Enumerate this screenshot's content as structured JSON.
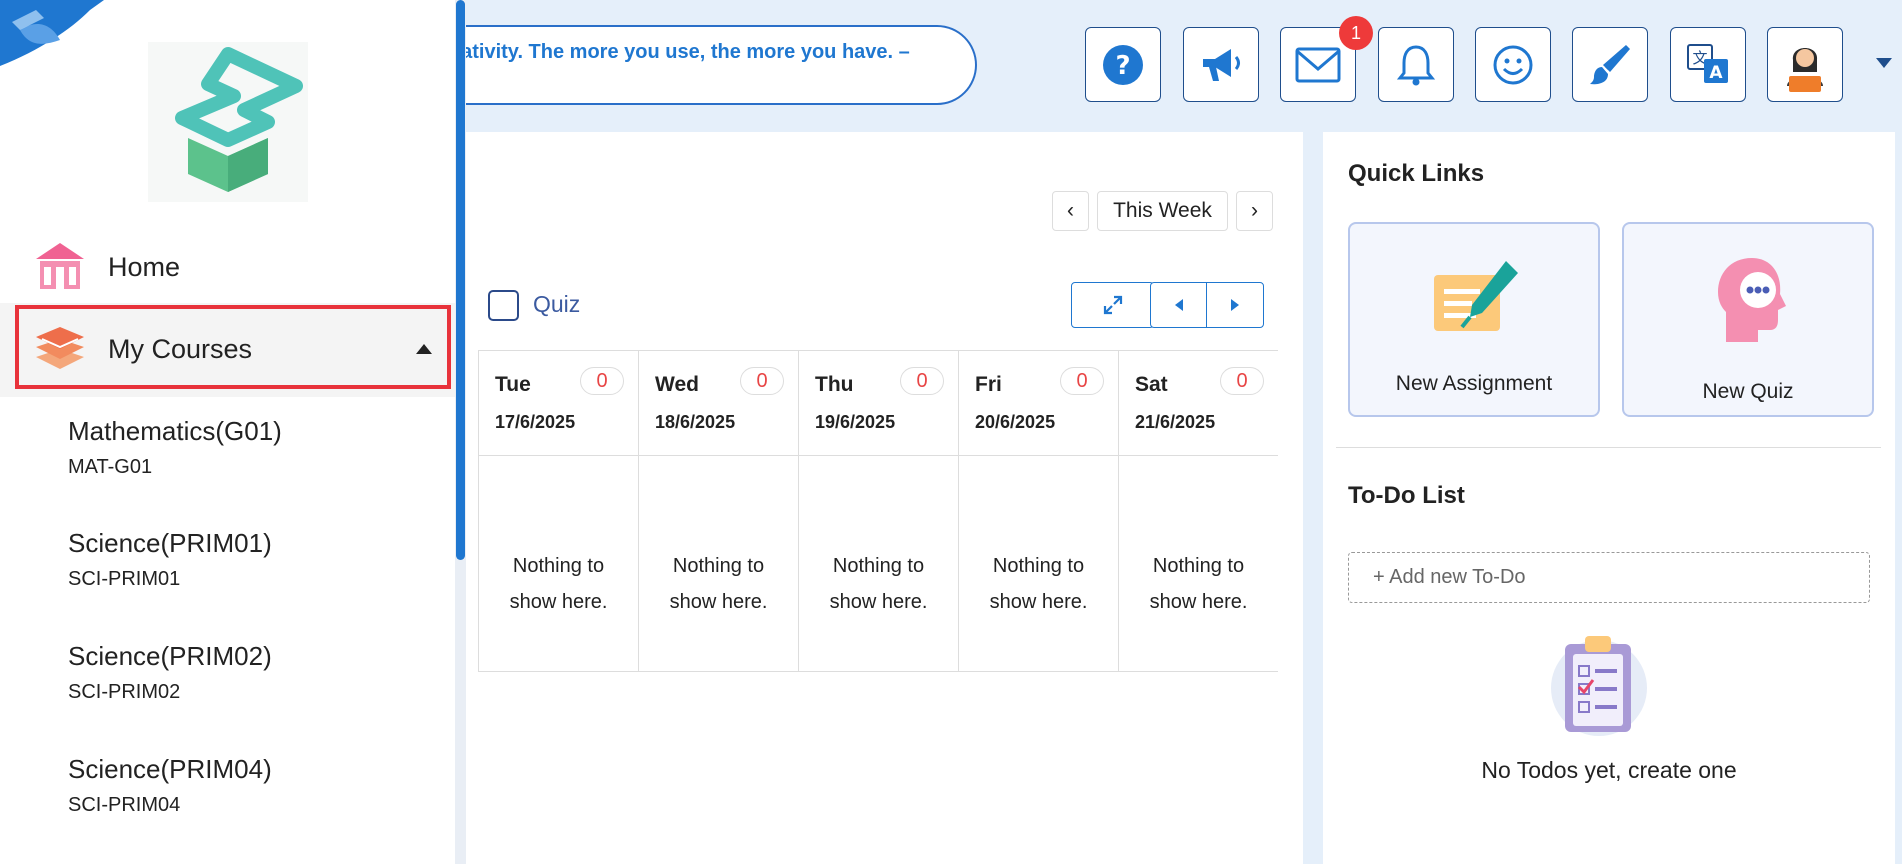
{
  "header": {
    "quote": "eativity. The more you use, the more you have. –",
    "icons": [
      {
        "name": "help-icon"
      },
      {
        "name": "megaphone-icon"
      },
      {
        "name": "mail-icon",
        "badge": "1"
      },
      {
        "name": "bell-icon"
      },
      {
        "name": "smiley-icon"
      },
      {
        "name": "paintbrush-icon"
      },
      {
        "name": "translate-icon"
      },
      {
        "name": "user-avatar-icon"
      }
    ]
  },
  "sidebar": {
    "home_label": "Home",
    "courses_label": "My Courses",
    "courses": [
      {
        "name": "Mathematics(G01)",
        "code": "MAT-G01"
      },
      {
        "name": "Science(PRIM01)",
        "code": "SCI-PRIM01"
      },
      {
        "name": "Science(PRIM02)",
        "code": "SCI-PRIM02"
      },
      {
        "name": "Science(PRIM04)",
        "code": "SCI-PRIM04"
      }
    ]
  },
  "calendar": {
    "week_label": "This Week",
    "prev_label": "‹",
    "next_label": "›",
    "filter_label": "Quiz",
    "empty_line1": "Nothing to",
    "empty_line2": "show here.",
    "days": [
      {
        "name": "Tue",
        "date": "17/6/2025",
        "count": "0"
      },
      {
        "name": "Wed",
        "date": "18/6/2025",
        "count": "0"
      },
      {
        "name": "Thu",
        "date": "19/6/2025",
        "count": "0"
      },
      {
        "name": "Fri",
        "date": "20/6/2025",
        "count": "0"
      },
      {
        "name": "Sat",
        "date": "21/6/2025",
        "count": "0"
      }
    ]
  },
  "quick_links": {
    "title": "Quick Links",
    "new_assignment": "New Assignment",
    "new_quiz": "New Quiz"
  },
  "todo": {
    "title": "To-Do List",
    "placeholder": "+ Add new To-Do",
    "empty_text": "No Todos yet, create one"
  },
  "colors": {
    "accent": "#1f77d0",
    "highlight": "#e8323b",
    "badge": "#ee3a3a",
    "logo_teal": "#4fc3b8"
  }
}
